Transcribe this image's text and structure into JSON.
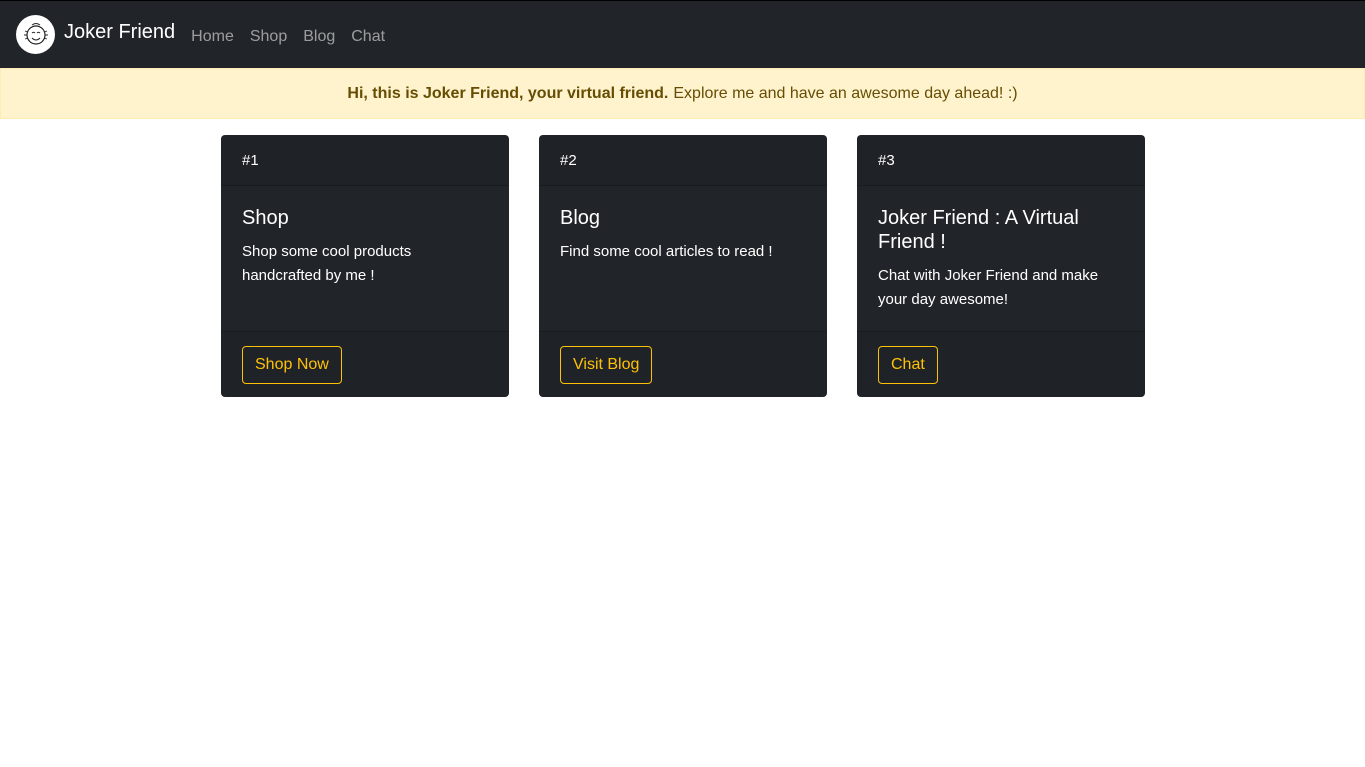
{
  "navbar": {
    "brand": "Joker Friend",
    "logo_icon": "smiley-face-icon",
    "links": [
      {
        "label": "Home"
      },
      {
        "label": "Shop"
      },
      {
        "label": "Blog"
      },
      {
        "label": "Chat"
      }
    ]
  },
  "alert": {
    "bold": "Hi, this is Joker Friend, your virtual friend.",
    "text": "Explore me and have an awesome day ahead! :)"
  },
  "cards": [
    {
      "header": "#1",
      "title": "Shop",
      "text": "Shop some cool products handcrafted by me !",
      "button": "Shop Now"
    },
    {
      "header": "#2",
      "title": "Blog",
      "text": "Find some cool articles to read !",
      "button": "Visit Blog"
    },
    {
      "header": "#3",
      "title": "Joker Friend : A Virtual Friend !",
      "text": "Chat with Joker Friend and make your day awesome!",
      "button": "Chat"
    }
  ],
  "colors": {
    "navbar_bg": "#212529",
    "alert_bg": "#fff3cd",
    "alert_text": "#664d03",
    "accent": "#ffc107",
    "card_bg": "#212529"
  }
}
